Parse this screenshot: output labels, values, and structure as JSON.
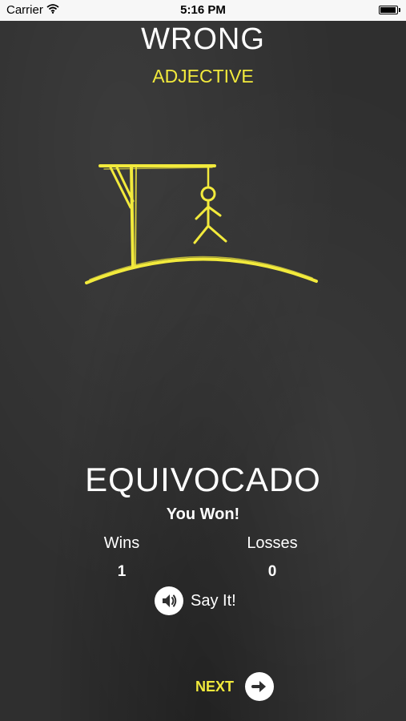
{
  "status_bar": {
    "carrier": "Carrier",
    "time": "5:16 PM",
    "battery_level": 1.0
  },
  "word": {
    "title": "WRONG",
    "part_of_speech": "ADJECTIVE"
  },
  "result": {
    "translation": "EQUIVOCADO",
    "message": "You Won!",
    "wins_label": "Wins",
    "wins_value": "1",
    "losses_label": "Losses",
    "losses_value": "0"
  },
  "actions": {
    "say_it_label": "Say It!",
    "next_label": "NEXT"
  },
  "icons": {
    "speaker": "speaker-icon",
    "next": "arrow-right-icon",
    "wifi": "wifi-icon",
    "battery": "battery-icon"
  },
  "colors": {
    "chalk_yellow": "#f2ea3c",
    "chalkboard": "#2f2f2f",
    "text": "#ffffff"
  }
}
